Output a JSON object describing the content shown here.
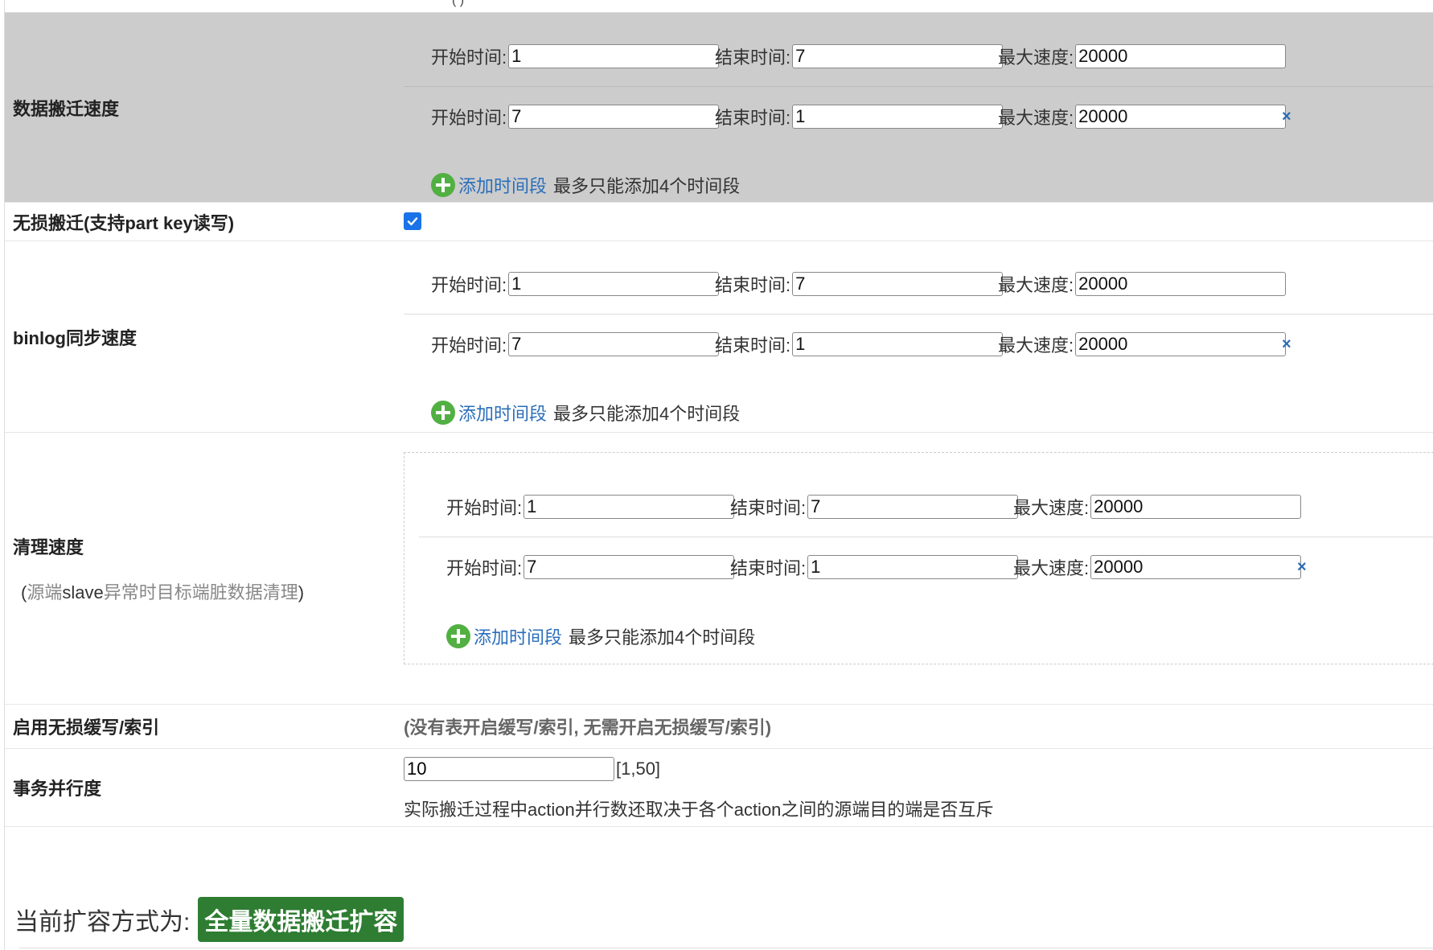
{
  "top_partial_text": "(        )",
  "labels": {
    "start": "开始时间:",
    "end": "结束时间:",
    "max": "最大速度:"
  },
  "add_period": "添加时间段",
  "add_hint": "最多只能添加4个时间段",
  "delete_symbol": "×",
  "sections": {
    "data_migration": {
      "title": "数据搬迁速度",
      "periods": [
        {
          "start": "1",
          "end": "7",
          "max": "20000"
        },
        {
          "start": "7",
          "end": "1",
          "max": "20000"
        }
      ]
    },
    "lossless": {
      "title": "无损搬迁(支持part key读写)",
      "checked": true
    },
    "binlog": {
      "title": "binlog同步速度",
      "periods": [
        {
          "start": "1",
          "end": "7",
          "max": "20000"
        },
        {
          "start": "7",
          "end": "1",
          "max": "20000"
        }
      ]
    },
    "cleanup": {
      "title": "清理速度",
      "subtitle_open": "(",
      "subtitle_gray1": "源端",
      "subtitle_dark": "slave",
      "subtitle_gray2": "异常时目标端脏数据清理",
      "subtitle_close": ")",
      "periods": [
        {
          "start": "1",
          "end": "7",
          "max": "20000"
        },
        {
          "start": "7",
          "end": "1",
          "max": "20000"
        }
      ]
    },
    "lossless_cache": {
      "title": "启用无损缓写/索引",
      "notice": "(没有表开启缓写/索引, 无需开启无损缓写/索引)"
    },
    "tx_parallel": {
      "title": "事务并行度",
      "value": "10",
      "range": "[1,50]",
      "note": "实际搬迁过程中action并行数还取决于各个action之间的源端目的端是否互斥"
    }
  },
  "footer": {
    "label": "当前扩容方式为:",
    "badge": "全量数据搬迁扩容"
  },
  "colors": {
    "gray_bg": "#cccccc",
    "link": "#2a6ebb",
    "plus_green": "#52b043",
    "badge_green": "#2e7d32",
    "checkbox_blue": "#1a73e8"
  }
}
